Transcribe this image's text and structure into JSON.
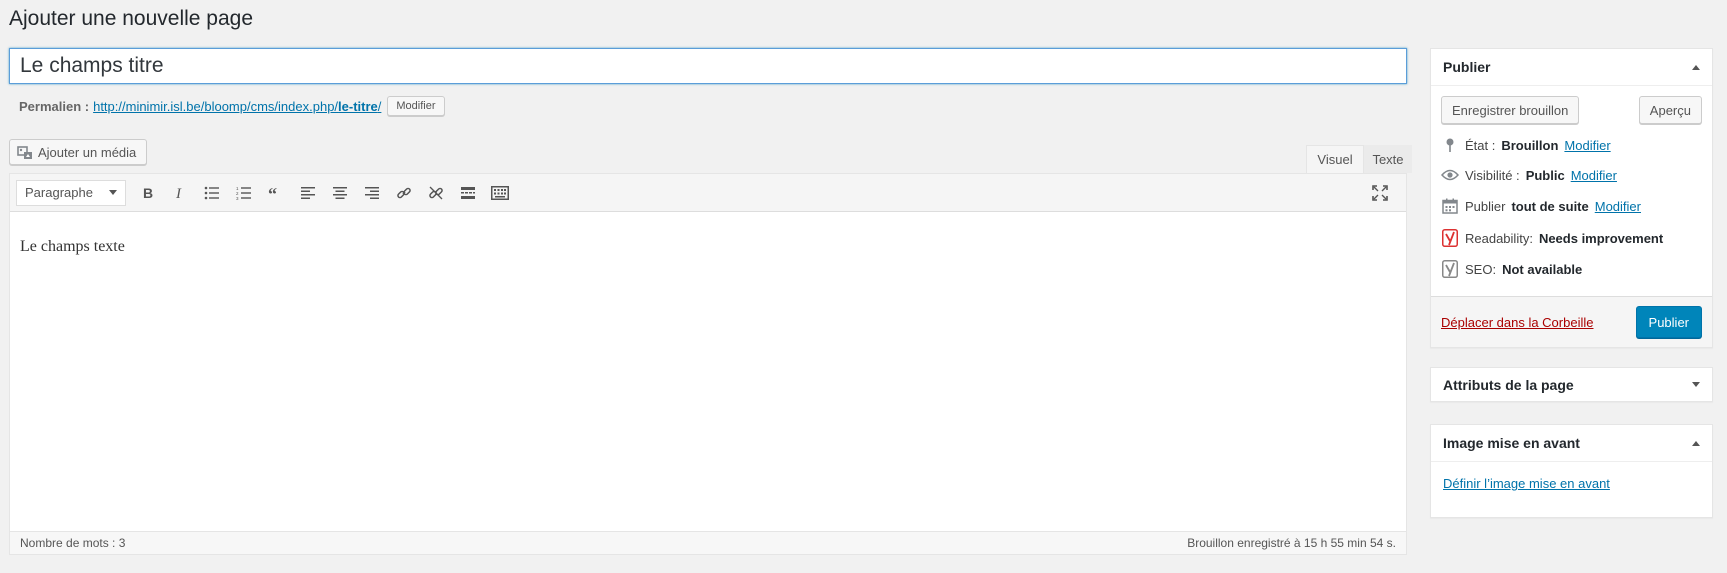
{
  "page": {
    "title": "Ajouter une nouvelle page"
  },
  "post_title": {
    "value": "Le champs titre"
  },
  "permalink": {
    "label": "Permalien :",
    "url_prefix": "http://minimir.isl.be/bloomp/cms/index.php/",
    "slug": "le-titre",
    "url_suffix": "/",
    "edit_label": "Modifier"
  },
  "media": {
    "label": "Ajouter un média"
  },
  "editor": {
    "tabs": {
      "visual": "Visuel",
      "text": "Texte"
    },
    "format_select": "Paragraphe",
    "toolbar_icons": [
      "bold-icon",
      "italic-icon",
      "bullet-list-icon",
      "numbered-list-icon",
      "blockquote-icon",
      "align-left-icon",
      "align-center-icon",
      "align-right-icon",
      "link-icon",
      "unlink-icon",
      "read-more-icon",
      "toolbar-toggle-icon"
    ],
    "content": "Le champs texte",
    "word_count": "Nombre de mots : 3",
    "draft_status": "Brouillon enregistré à 15 h 55 min 54 s."
  },
  "publish": {
    "title": "Publier",
    "save_draft": "Enregistrer brouillon",
    "preview": "Aperçu",
    "status_label": "État :",
    "status_value": "Brouillon",
    "status_edit": "Modifier",
    "visibility_label": "Visibilité :",
    "visibility_value": "Public",
    "visibility_edit": "Modifier",
    "schedule_label": "Publier",
    "schedule_value": "tout de suite",
    "schedule_edit": "Modifier",
    "readability_label": "Readability:",
    "readability_value": "Needs improvement",
    "seo_label": "SEO:",
    "seo_value": "Not available",
    "trash": "Déplacer dans la Corbeille",
    "publish_button": "Publier"
  },
  "page_attributes": {
    "title": "Attributs de la page"
  },
  "featured_image": {
    "title": "Image mise en avant",
    "set_link": "Définir l’image mise en avant"
  },
  "colors": {
    "primary": "#0085ba",
    "link": "#0073aa",
    "trash": "#aa0000",
    "yoast_red": "#dc3232"
  }
}
